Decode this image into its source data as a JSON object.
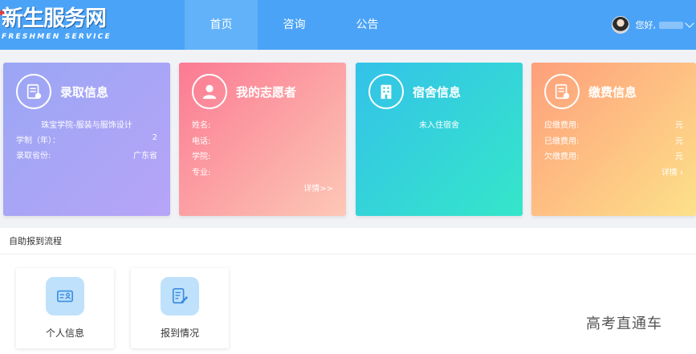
{
  "logo": {
    "main": "新生服务网",
    "sub": "FRESHMEN SERVICE"
  },
  "nav": {
    "items": [
      "首页",
      "咨询",
      "公告"
    ],
    "active": "首页"
  },
  "user": {
    "greeting": "您好,"
  },
  "cards": {
    "admission": {
      "title": "录取信息",
      "major": "珠宝学院-服装与服饰设计",
      "duration_label": "学制（年）：",
      "duration_value": "2",
      "province_label": "录取省份:",
      "province_value": "广东省"
    },
    "volunteer": {
      "title": "我的志愿者",
      "fields": [
        "姓名:",
        "电话:",
        "学院:",
        "专业:"
      ],
      "more": "详情>>"
    },
    "dorm": {
      "title": "宿舍信息",
      "status": "未入住宿舍"
    },
    "payment": {
      "title": "缴费信息",
      "rows": [
        {
          "label": "应缴费用:",
          "value": "元"
        },
        {
          "label": "已缴费用:",
          "value": "元"
        },
        {
          "label": "欠缴费用:",
          "value": "元"
        }
      ],
      "more": "详情 ›"
    }
  },
  "section": {
    "title": "自助报到流程"
  },
  "tiles": [
    {
      "label": "个人信息",
      "icon": "id-card-icon"
    },
    {
      "label": "报到情况",
      "icon": "edit-document-icon"
    }
  ],
  "watermark": "高考直通车",
  "colors": {
    "header": "#4aa3f7",
    "nav_active": "#62b2f9"
  }
}
